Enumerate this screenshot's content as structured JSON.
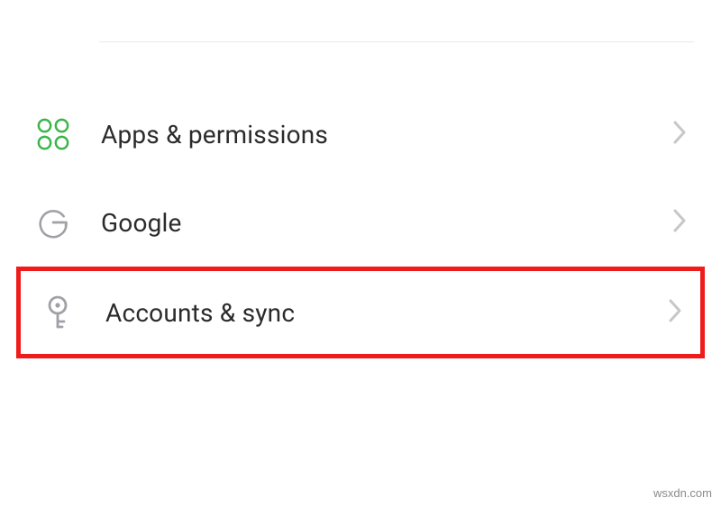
{
  "settings": {
    "items": [
      {
        "id": "apps-permissions",
        "label": "Apps & permissions"
      },
      {
        "id": "google",
        "label": "Google"
      },
      {
        "id": "accounts-sync",
        "label": "Accounts & sync"
      }
    ]
  },
  "highlighted_index": 2,
  "colors": {
    "highlight": "#ef1c1c",
    "icon_green": "#3bb54a",
    "icon_grey": "#a0a0a7",
    "text": "#2b2b2b"
  },
  "watermark": "wsxdn.com"
}
